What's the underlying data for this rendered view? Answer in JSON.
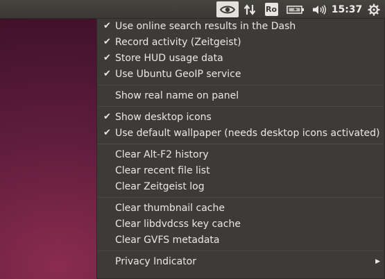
{
  "panel": {
    "clock": "15:37",
    "keyboard_layout": "Ro",
    "icons": {
      "privacy": "eye-icon",
      "network": "network-arrows-icon",
      "battery": "battery-icon",
      "sound": "speaker-icon",
      "session": "gear-icon"
    }
  },
  "menu": {
    "items": [
      {
        "label": "Use online search results in the Dash",
        "checked": true
      },
      {
        "label": "Record activity (Zeitgeist)",
        "checked": true
      },
      {
        "label": "Store HUD usage data",
        "checked": true
      },
      {
        "label": "Use Ubuntu GeoIP service",
        "checked": true
      },
      {
        "label": "Show real name on panel",
        "checked": false
      },
      {
        "label": "Show desktop icons",
        "checked": true
      },
      {
        "label": "Use default wallpaper (needs desktop icons activated)",
        "checked": true
      },
      {
        "label": "Clear Alt-F2 history",
        "checked": false
      },
      {
        "label": "Clear recent file list",
        "checked": false
      },
      {
        "label": "Clear Zeitgeist log",
        "checked": false
      },
      {
        "label": "Clear thumbnail cache",
        "checked": false
      },
      {
        "label": "Clear libdvdcss key cache",
        "checked": false
      },
      {
        "label": "Clear GVFS metadata",
        "checked": false
      },
      {
        "label": "Privacy Indicator",
        "checked": false,
        "submenu": true
      }
    ],
    "check_glyph": "✔",
    "submenu_glyph": "▶"
  }
}
